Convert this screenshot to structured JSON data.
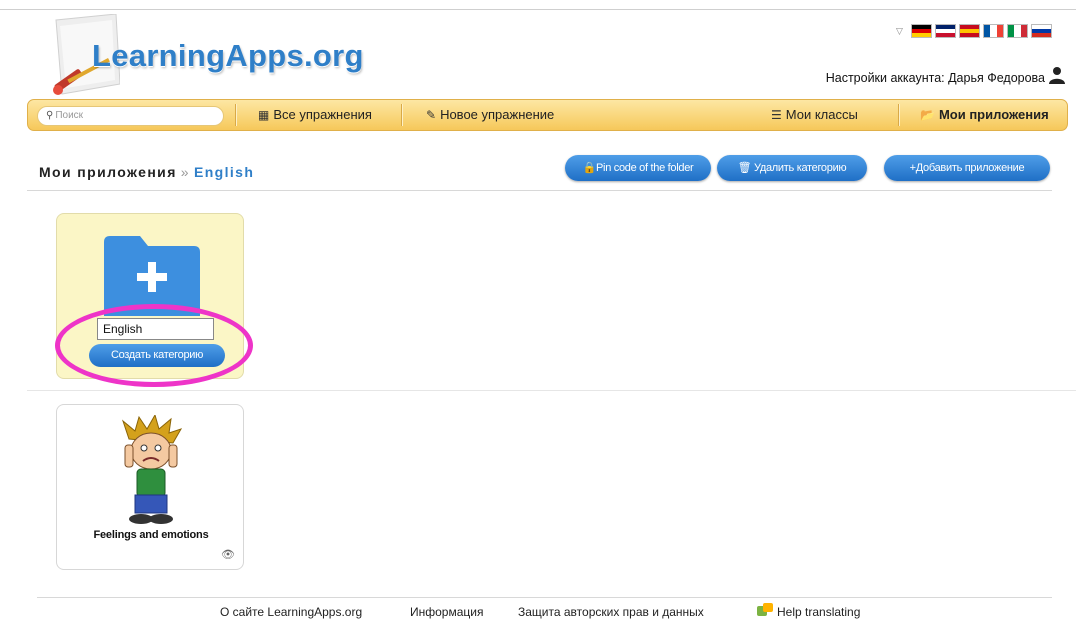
{
  "site": {
    "logo_text": "LearningApps.org"
  },
  "header": {
    "language_flags": [
      {
        "name": "german-flag-icon",
        "colors": [
          "#000000",
          "#dd0000",
          "#ffce00"
        ]
      },
      {
        "name": "uk-flag-icon",
        "colors": [
          "#012169",
          "#ffffff",
          "#c8102e"
        ]
      },
      {
        "name": "spanish-flag-icon",
        "colors": [
          "#c60b1e",
          "#ffc400",
          "#c60b1e"
        ]
      },
      {
        "name": "french-flag-icon",
        "colors": [
          "#0055a4",
          "#ffffff",
          "#ef4135"
        ]
      },
      {
        "name": "italian-flag-icon",
        "colors": [
          "#009246",
          "#ffffff",
          "#ce2b37"
        ]
      },
      {
        "name": "russian-flag-icon",
        "colors": [
          "#ffffff",
          "#0039a6",
          "#d52b1e"
        ]
      }
    ],
    "account_label": "Настройки аккаунта: Дарья Федорова"
  },
  "nav": {
    "search_placeholder": "Поиск",
    "all_exercises": "Все упражнения",
    "new_exercise": "Новое упражнение",
    "my_classes": "Мои классы",
    "my_apps": "Мои приложения"
  },
  "breadcrumb": {
    "root": "Мои приложения",
    "separator": "»",
    "current": "English"
  },
  "toolbar": {
    "pin_code": "Pin code of the folder",
    "delete_category": "Удалить категорию",
    "add_app": "+Добавить приложение"
  },
  "new_category": {
    "input_value": "English",
    "create_label": "Создать категорию"
  },
  "apps": [
    {
      "title": "Feelings and emotions"
    }
  ],
  "footer": {
    "about": "О сайте LearningApps.org",
    "info": "Информация",
    "privacy": "Защита авторских прав и данных",
    "help_translating": "Help translating"
  },
  "colors": {
    "accent": "#2f7fc8",
    "navbar": "#f6c85a",
    "highlight": "#ee34c8",
    "tile_new": "#fbf6c6"
  }
}
